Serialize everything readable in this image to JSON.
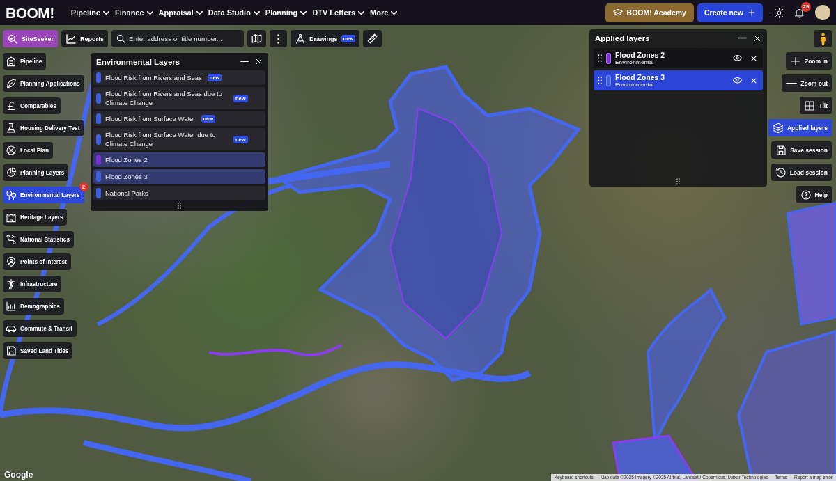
{
  "top_bar": {
    "logo": "BOOM!",
    "nav": [
      {
        "label": "Pipeline"
      },
      {
        "label": "Finance"
      },
      {
        "label": "Appraisal"
      },
      {
        "label": "Data Studio"
      },
      {
        "label": "Planning"
      },
      {
        "label": "DTV Letters"
      },
      {
        "label": "More"
      }
    ],
    "academy_button": "BOOM! Academy",
    "create_button": "Create new",
    "notification_count": "29"
  },
  "map_toolbar": {
    "siteseeker": {
      "label": "SiteSeeker",
      "selected": true
    },
    "reports": {
      "label": "Reports",
      "selected": false
    },
    "search": {
      "placeholder": "Enter address or title number..."
    },
    "drawings": {
      "label": "Drawings",
      "badge": "new"
    }
  },
  "sidebar": {
    "items": [
      {
        "label": "Pipeline",
        "selected": false
      },
      {
        "label": "Planning Applications",
        "selected": false
      },
      {
        "label": "Comparables",
        "selected": false
      },
      {
        "label": "Housing Delivery Test",
        "selected": false
      },
      {
        "label": "Local Plan",
        "selected": false
      },
      {
        "label": "Planning Layers",
        "selected": false
      },
      {
        "label": "Environmental Layers",
        "selected": true,
        "badge": "2"
      },
      {
        "label": "Heritage Layers",
        "selected": false
      },
      {
        "label": "National Statistics",
        "selected": false
      },
      {
        "label": "Points of Interest",
        "selected": false
      },
      {
        "label": "Infrastructure",
        "selected": false
      },
      {
        "label": "Demographics",
        "selected": false
      },
      {
        "label": "Commute & Transit",
        "selected": false
      },
      {
        "label": "Saved Land Titles",
        "selected": false
      }
    ]
  },
  "environmental_layers": {
    "title": "Environmental Layers",
    "items": [
      {
        "label": "Flood Risk from Rivers and Seas",
        "badge": "new",
        "color": "#3b5fe0",
        "selected": false
      },
      {
        "label": "Flood Risk from Rivers and Seas due to Climate Change",
        "badge": "new",
        "color": "#3b5fe0",
        "selected": false
      },
      {
        "label": "Flood Risk from Surface Water",
        "badge": "new",
        "color": "#3b5fe0",
        "selected": false
      },
      {
        "label": "Flood Risk from Surface Water due to Climate Change",
        "badge": "new",
        "color": "#3b5fe0",
        "selected": false
      },
      {
        "label": "Flood Zones 2",
        "color": "#7c2fd0",
        "selected": true
      },
      {
        "label": "Flood Zones 3",
        "color": "#3b5fe0",
        "selected": true
      },
      {
        "label": "National Parks",
        "color": "#3b5fe0",
        "selected": false
      }
    ]
  },
  "applied_layers": {
    "title": "Applied layers",
    "items": [
      {
        "name": "Flood Zones 2",
        "category": "Environmental",
        "color": "#7c2fd0",
        "selected": false
      },
      {
        "name": "Flood Zones 3",
        "category": "Environmental",
        "color": "#3b5fe0",
        "selected": true
      }
    ]
  },
  "map_controls": [
    {
      "label": "Zoom in",
      "selected": false
    },
    {
      "label": "Zoom out",
      "selected": false
    },
    {
      "label": "Tilt",
      "selected": false
    },
    {
      "label": "Applied layers",
      "selected": true
    },
    {
      "label": "Save session",
      "selected": false
    },
    {
      "label": "Load session",
      "selected": false
    },
    {
      "label": "Help",
      "selected": false
    }
  ],
  "map_footer": {
    "logo": "Google",
    "attribution": [
      "Keyboard shortcuts",
      "Map data ©2025 Imagery ©2025 Airbus, Landsat / Copernicus, Maxar Technologies",
      "Terms",
      "Report a map error"
    ]
  }
}
